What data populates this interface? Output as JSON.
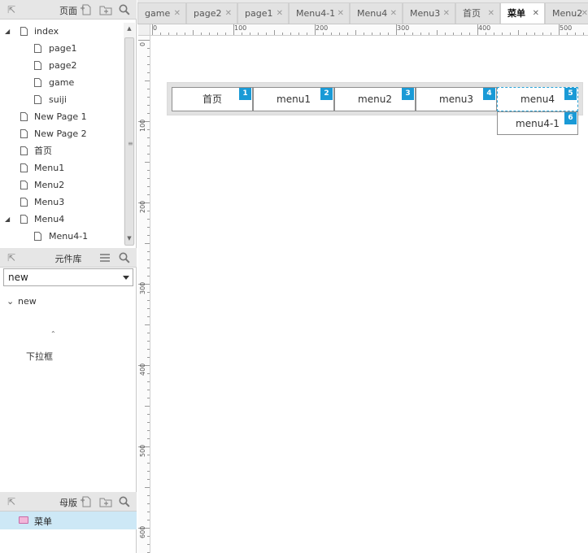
{
  "pages_panel": {
    "title": "页面",
    "items": [
      {
        "label": "index",
        "expanded": true
      },
      {
        "label": "page1"
      },
      {
        "label": "page2"
      },
      {
        "label": "game"
      },
      {
        "label": "suiji"
      },
      {
        "label": "New Page 1"
      },
      {
        "label": "New Page 2"
      },
      {
        "label": "首页"
      },
      {
        "label": "Menu1"
      },
      {
        "label": "Menu2"
      },
      {
        "label": "Menu3"
      },
      {
        "label": "Menu4",
        "expanded": true
      },
      {
        "label": "Menu4-1"
      }
    ]
  },
  "library_panel": {
    "title": "元件库",
    "selected_library": "new",
    "group_label": "new",
    "widget_label": "下拉框"
  },
  "masters_panel": {
    "title": "母版",
    "items": [
      {
        "label": "菜单"
      }
    ]
  },
  "tabs": [
    {
      "label": "game"
    },
    {
      "label": "page2"
    },
    {
      "label": "page1"
    },
    {
      "label": "Menu4-1"
    },
    {
      "label": "Menu4"
    },
    {
      "label": "Menu3"
    },
    {
      "label": "首页"
    },
    {
      "label": "菜单",
      "active": true
    },
    {
      "label": "Menu2"
    }
  ],
  "rulers": {
    "horizontal": [
      "0",
      "100",
      "200",
      "300",
      "400",
      "500"
    ],
    "vertical": [
      "0",
      "100",
      "200",
      "300",
      "400",
      "500",
      "600"
    ]
  },
  "canvas": {
    "menu_items": [
      {
        "label": "首页",
        "badge": "1"
      },
      {
        "label": "menu1",
        "badge": "2"
      },
      {
        "label": "menu2",
        "badge": "3"
      },
      {
        "label": "menu3",
        "badge": "4"
      },
      {
        "label": "menu4",
        "badge": "5",
        "selected": true
      }
    ],
    "submenu": {
      "label": "menu4-1",
      "badge": "6"
    }
  },
  "colors": {
    "badge": "#1a9ad6",
    "selection": "#2aa3d8",
    "master_highlight": "#cde8f6"
  }
}
